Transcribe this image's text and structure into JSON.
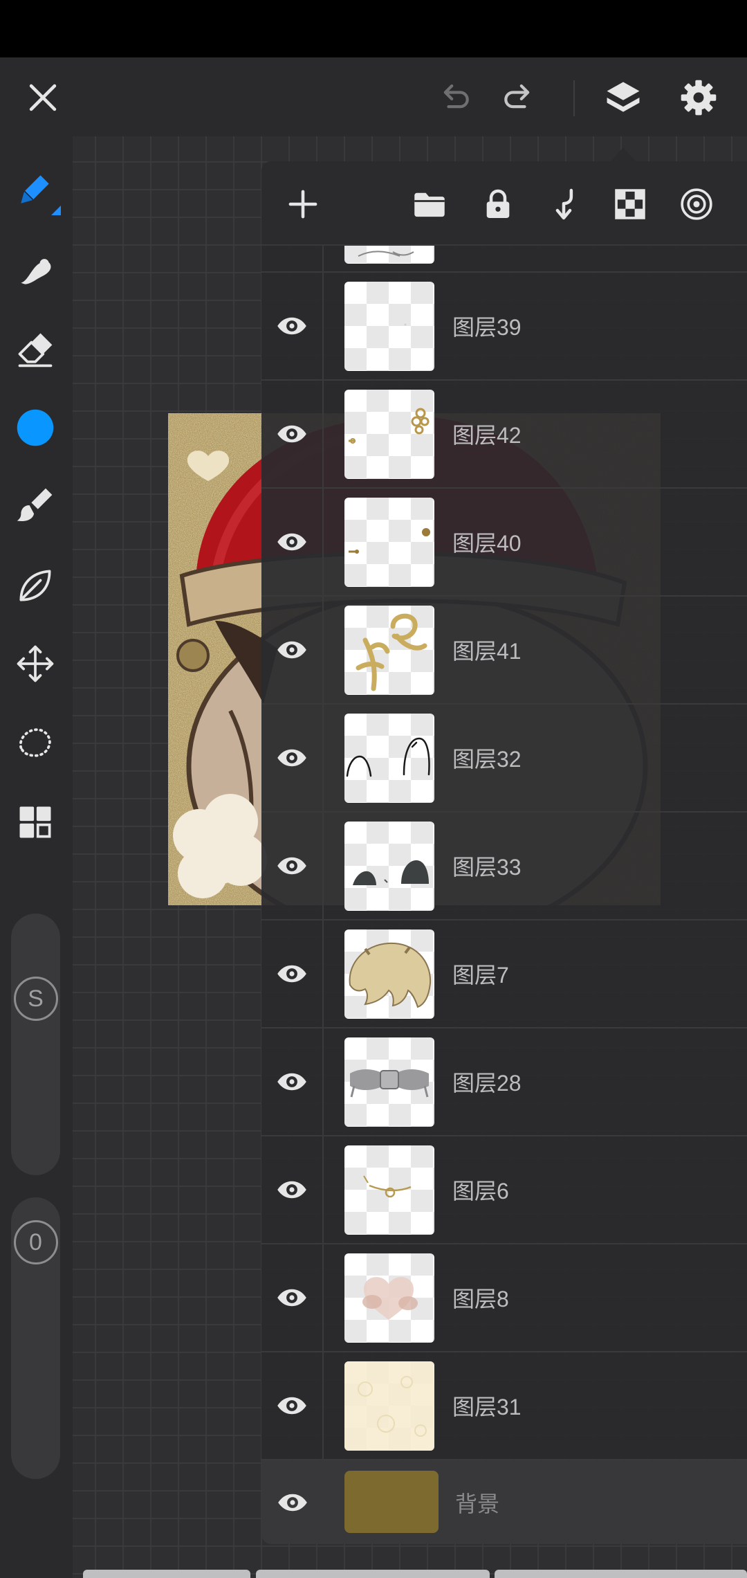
{
  "top_bar": {
    "close_icon": "close-icon",
    "undo_icon": "undo-icon",
    "redo_icon": "redo-icon",
    "layers_icon": "layers-icon",
    "settings_icon": "gear-icon"
  },
  "tools": [
    {
      "icon": "pen-icon",
      "active": true
    },
    {
      "icon": "smudge-icon",
      "active": false
    },
    {
      "icon": "eraser-icon",
      "active": false
    },
    {
      "icon": "color-swatch-icon",
      "active": false
    },
    {
      "icon": "brush-icon",
      "active": false
    },
    {
      "icon": "leaf-icon",
      "active": false
    },
    {
      "icon": "move-icon",
      "active": false
    },
    {
      "icon": "lasso-icon",
      "active": false
    },
    {
      "icon": "grid-icon",
      "active": false
    }
  ],
  "sliders": {
    "size": {
      "label": "S"
    },
    "opacity": {
      "label": "0"
    }
  },
  "colors": {
    "accent": "#1e8fff",
    "current_color": "#0a96ff",
    "background_layer": "#7d6a2f",
    "canvas_bg": "#2f2f31"
  },
  "layers_panel": {
    "actions": [
      "add-icon",
      "folder-icon",
      "lock-icon",
      "merge-down-icon",
      "checker-icon",
      "target-icon"
    ],
    "layers": [
      {
        "name": "图层39",
        "visible": true
      },
      {
        "name": "图层42",
        "visible": true
      },
      {
        "name": "图层40",
        "visible": true
      },
      {
        "name": "图层41",
        "visible": true
      },
      {
        "name": "图层32",
        "visible": true
      },
      {
        "name": "图层33",
        "visible": true
      },
      {
        "name": "图层7",
        "visible": true
      },
      {
        "name": "图层28",
        "visible": true
      },
      {
        "name": "图层6",
        "visible": true
      },
      {
        "name": "图层8",
        "visible": true
      },
      {
        "name": "图层31",
        "visible": true
      }
    ],
    "background_layer": {
      "name": "背景",
      "visible": true
    }
  }
}
